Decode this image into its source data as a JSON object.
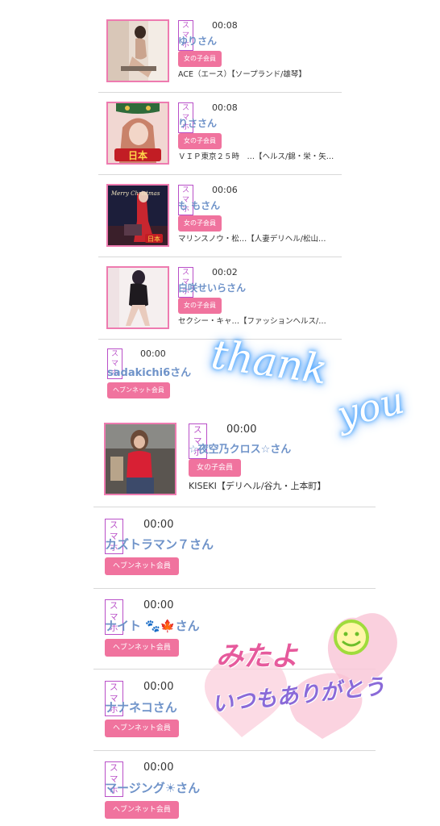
{
  "entries": [
    {
      "device": "スマホ",
      "time": "00:08",
      "name": "ゆりさん",
      "badge": "女の子会員",
      "shop": "ACE（エース）【ソープランド/雄琴】"
    },
    {
      "device": "スマホ",
      "time": "00:08",
      "name": "りささん",
      "badge": "女の子会員",
      "shop": "ＶＩＰ東京２５時　…【ヘルス/錦・栄・矢…"
    },
    {
      "device": "スマホ",
      "time": "00:06",
      "name": "も もさん",
      "badge": "女の子会員",
      "shop": "マリンスノウ・松…【人妻デリヘル/松山…"
    },
    {
      "device": "スマホ",
      "time": "00:02",
      "name": "白咲せいらさん",
      "badge": "女の子会員",
      "shop": "セクシー・キャ…【ファッションヘルス/…"
    },
    {
      "device": "スマホ",
      "time": "00:00",
      "name": "sadakichi6さん",
      "badge": "ヘブンネット会員"
    },
    {
      "device": "スマホ",
      "time": "00:00",
      "name": "☆夜空乃クロス☆さん",
      "badge": "女の子会員",
      "shop": "KISEKI【デリヘル/谷九・上本町】"
    },
    {
      "device": "スマホ",
      "time": "00:00",
      "name": "カズトラマン７さん",
      "badge": "ヘブンネット会員"
    },
    {
      "device": "スマホ",
      "time": "00:00",
      "name": "ナイト 🐾🍁さん",
      "badge": "ヘブンネット会員"
    },
    {
      "device": "スマホ",
      "time": "00:00",
      "name": "ナナネコさん",
      "badge": "ヘブンネット会員"
    },
    {
      "device": "スマホ",
      "time": "00:00",
      "name": "マージング☀さん",
      "badge": "ヘブンネット会員"
    }
  ],
  "stickers": {
    "thank": "thank",
    "you": "you",
    "mitayo": "みたよ",
    "itsumo": "いつもありがとう"
  },
  "thumb_labels": {
    "risa": "日本",
    "momo_top": "Merry Christmas",
    "momo_bottom": "日本"
  },
  "colors": {
    "name_blue": "#6f93c9",
    "badge_pink": "#f0739e",
    "device_purple": "#b94fc8",
    "thumb_border": "#ee7bb0",
    "glow_blue": "#4aa6ff"
  }
}
